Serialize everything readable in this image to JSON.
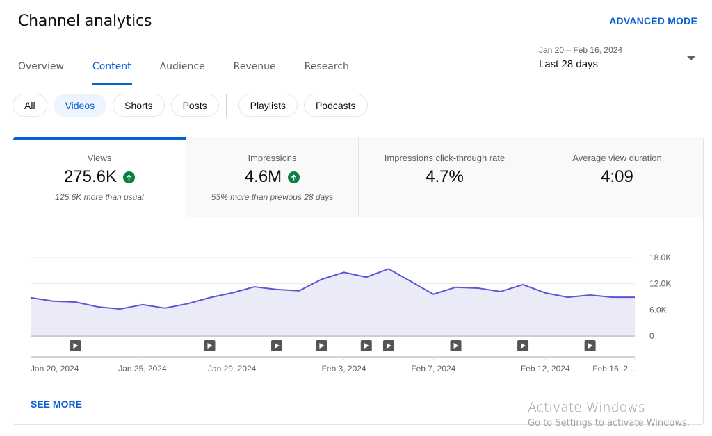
{
  "header": {
    "title": "Channel analytics",
    "advanced_mode": "ADVANCED MODE"
  },
  "tabs": [
    {
      "label": "Overview",
      "active": false
    },
    {
      "label": "Content",
      "active": true
    },
    {
      "label": "Audience",
      "active": false
    },
    {
      "label": "Revenue",
      "active": false
    },
    {
      "label": "Research",
      "active": false
    }
  ],
  "date_range": {
    "range": "Jan 20 – Feb 16, 2024",
    "label": "Last 28 days",
    "icon": "dropdown-caret-icon"
  },
  "chips": [
    {
      "label": "All",
      "active": false
    },
    {
      "label": "Videos",
      "active": true
    },
    {
      "label": "Shorts",
      "active": false
    },
    {
      "label": "Posts",
      "active": false
    },
    {
      "label": "Playlists",
      "active": false
    },
    {
      "label": "Podcasts",
      "active": false
    }
  ],
  "metrics": [
    {
      "name": "Views",
      "value": "275.6K",
      "trend": "up",
      "sub": "125.6K more than usual",
      "active": true
    },
    {
      "name": "Impressions",
      "value": "4.6M",
      "trend": "up",
      "sub": "53% more than previous 28 days",
      "active": false
    },
    {
      "name": "Impressions click-through rate",
      "value": "4.7%",
      "trend": null,
      "sub": "",
      "active": false
    },
    {
      "name": "Average view duration",
      "value": "4:09",
      "trend": null,
      "sub": "",
      "active": false
    }
  ],
  "colors": {
    "accent": "#065fd4",
    "line": "#5b55d8",
    "area": "#ebebf8",
    "trend_up": "#0b8043"
  },
  "chart_data": {
    "type": "area",
    "title": "",
    "xlabel": "",
    "ylabel": "Views",
    "y_axis_position": "right",
    "ylim": [
      0,
      18000
    ],
    "y_ticks": [
      "0",
      "6.0K",
      "12.0K",
      "18.0K"
    ],
    "y_tick_values": [
      0,
      6000,
      12000,
      18000
    ],
    "grid": true,
    "x": [
      "Jan 20",
      "Jan 21",
      "Jan 22",
      "Jan 23",
      "Jan 24",
      "Jan 25",
      "Jan 26",
      "Jan 27",
      "Jan 28",
      "Jan 29",
      "Jan 30",
      "Jan 31",
      "Feb 1",
      "Feb 2",
      "Feb 3",
      "Feb 4",
      "Feb 5",
      "Feb 6",
      "Feb 7",
      "Feb 8",
      "Feb 9",
      "Feb 10",
      "Feb 11",
      "Feb 12",
      "Feb 13",
      "Feb 14",
      "Feb 15",
      "Feb 16"
    ],
    "series": [
      {
        "name": "Views",
        "values": [
          8800,
          8000,
          7800,
          6700,
          6200,
          7200,
          6400,
          7400,
          8800,
          9900,
          11300,
          10700,
          10400,
          13000,
          14600,
          13500,
          15400,
          12500,
          9600,
          11200,
          11000,
          10200,
          11800,
          9900,
          8900,
          9400,
          8900,
          8900
        ]
      }
    ],
    "x_tick_labels": [
      {
        "index": 0,
        "label": "Jan 20, 2024"
      },
      {
        "index": 5,
        "label": "Jan 25, 2024"
      },
      {
        "index": 9,
        "label": "Jan 29, 2024"
      },
      {
        "index": 14,
        "label": "Feb 3, 2024"
      },
      {
        "index": 18,
        "label": "Feb 7, 2024"
      },
      {
        "index": 23,
        "label": "Feb 12, 2024"
      },
      {
        "index": 27,
        "label": "Feb 16, 2..."
      }
    ],
    "video_publish_markers": [
      2,
      8,
      11,
      13,
      15,
      16,
      19,
      22,
      25
    ]
  },
  "see_more": "SEE MORE",
  "watermark": {
    "line1": "Activate Windows",
    "line2": "Go to Settings to activate Windows."
  }
}
